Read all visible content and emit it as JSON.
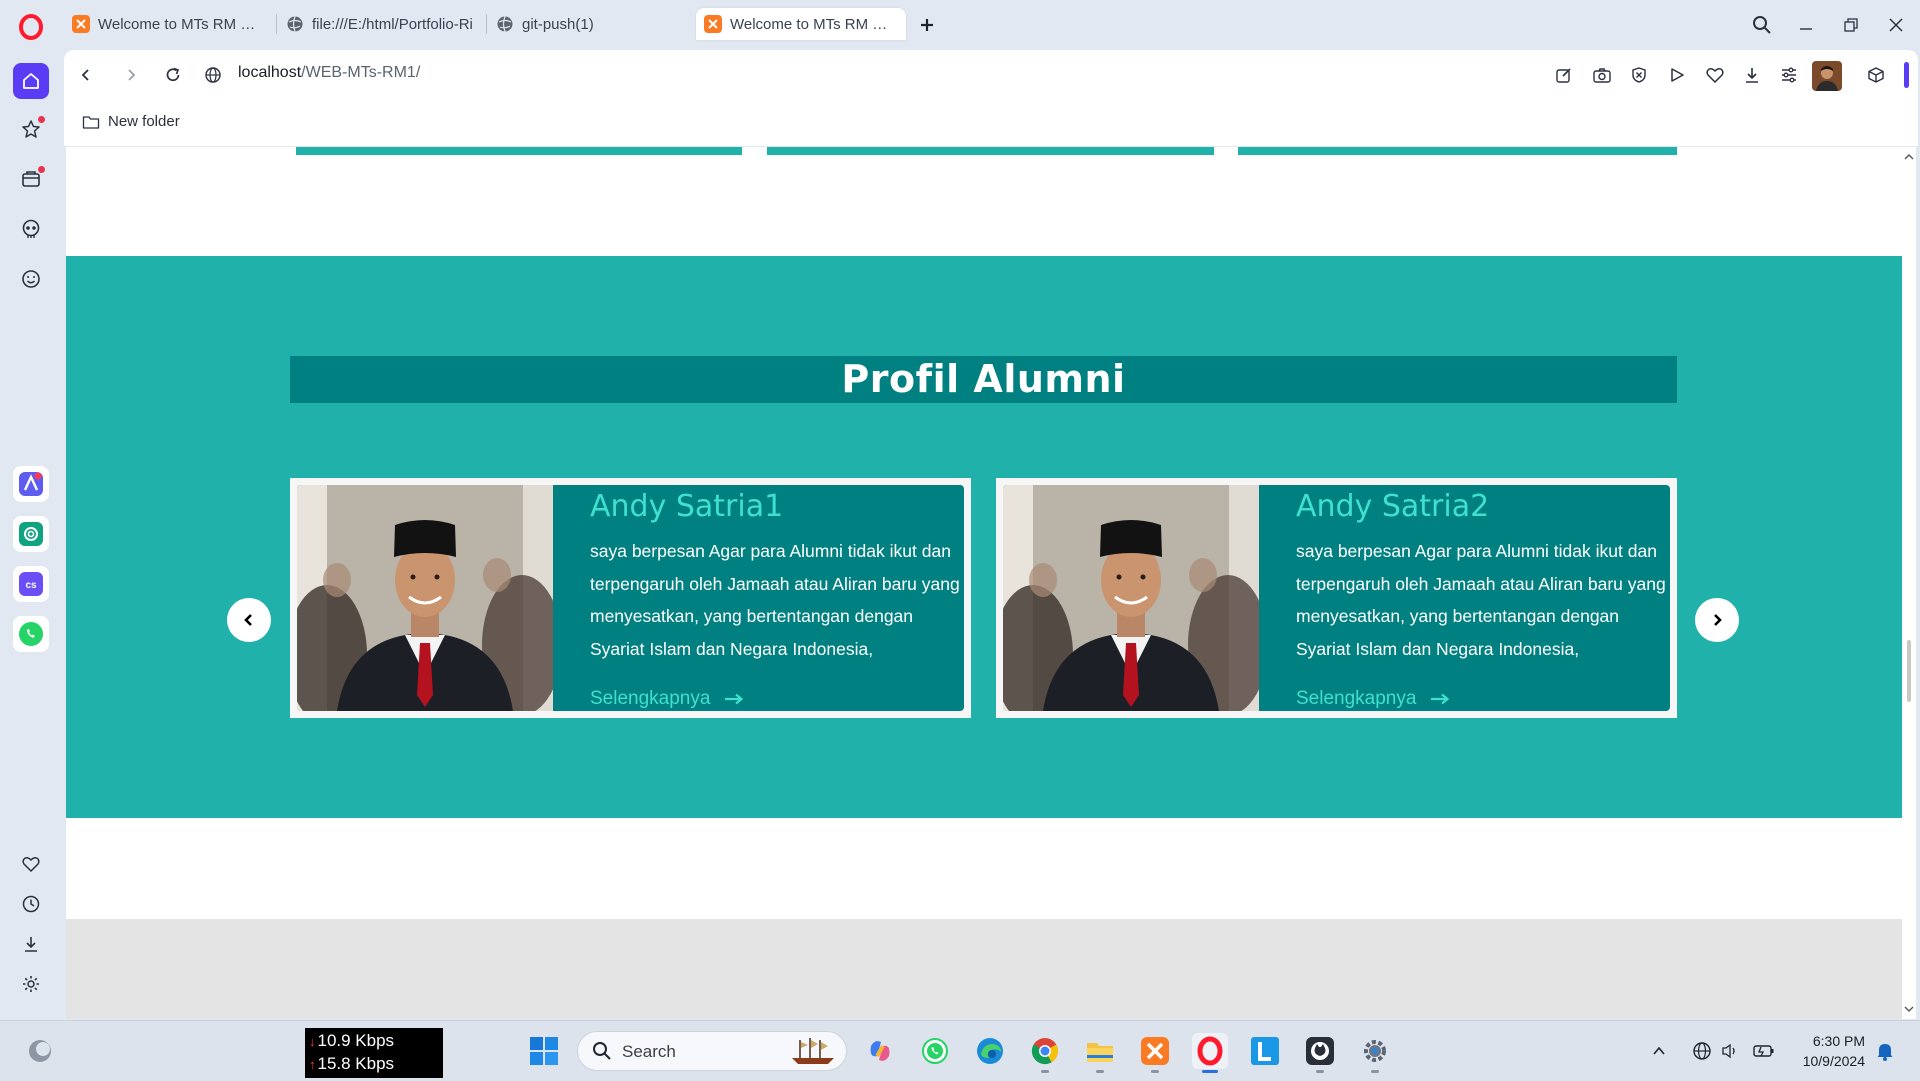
{
  "tabs": [
    {
      "title": "Welcome to MTs RM Web",
      "active": false,
      "favicon": "xampp-icon"
    },
    {
      "title": "file:///E:/html/Portfolio-Ri",
      "active": false,
      "favicon": "globe-icon"
    },
    {
      "title": "git-push(1)",
      "active": false,
      "favicon": "globe-icon"
    },
    {
      "title": "Welcome to MTs RM Web",
      "active": true,
      "favicon": "xampp-icon"
    }
  ],
  "address": {
    "host": "localhost",
    "path": "/WEB-MTs-RM1/"
  },
  "bookmarks": [
    {
      "label": "New folder",
      "icon": "folder-icon"
    }
  ],
  "page": {
    "section_title": "Profil Alumni",
    "cards": [
      {
        "name": "Andy Satria1",
        "message": "saya berpesan Agar para Alumni tidak ikut dan terpengaruh oleh Jamaah atau Aliran baru yang menyesatkan, yang bertentangan dengan Syariat Islam dan Negara Indonesia,",
        "link": "Selengkapnya"
      },
      {
        "name": "Andy Satria2",
        "message": "saya berpesan Agar para Alumni tidak ikut dan terpengaruh oleh Jamaah atau Aliran baru yang menyesatkan, yang bertentangan dengan Syariat Islam dan Negara Indonesia,",
        "link": "Selengkapnya"
      }
    ]
  },
  "taskbar": {
    "net_down": "10.9 Kbps",
    "net_up": "15.8 Kbps",
    "search_label": "Search",
    "time": "6:30 PM",
    "date": "10/9/2024"
  },
  "colors": {
    "teal_section": "#20b2aa",
    "teal_dark": "#008080",
    "turquoise_text": "#40e0d0",
    "opera_red": "#ff1b2d",
    "opera_accent": "#5b3cf5"
  }
}
